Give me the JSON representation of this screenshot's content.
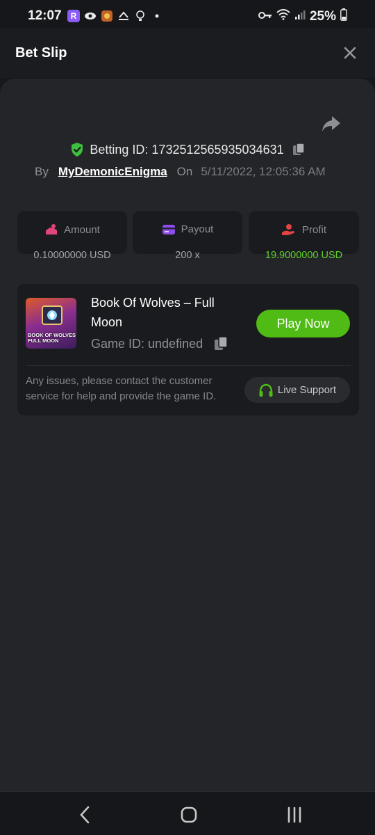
{
  "status_bar": {
    "time": "12:07",
    "battery": "25%",
    "app_badge": "R"
  },
  "header": {
    "title": "Bet Slip"
  },
  "bet": {
    "betting_id": "Betting ID: 1732512565935034631",
    "by_label": "By",
    "username": "MyDemonicEnigma",
    "on_label": "On",
    "date": "5/11/2022, 12:05:36 AM"
  },
  "stats": {
    "amount": {
      "label": "Amount",
      "value": "0.10000000 USD"
    },
    "payout": {
      "label": "Payout",
      "value": "200 x"
    },
    "profit": {
      "label": "Profit",
      "value": "19.9000000 USD"
    }
  },
  "game": {
    "title": "Book Of Wolves – Full Moon",
    "thumb_caption_1": "BOOK OF WOLVES",
    "thumb_caption_2": "FULL MOON",
    "game_id": "Game ID: undefined",
    "play_label": "Play Now",
    "issue_text": "Any issues, please contact the customer service for help and provide the game ID.",
    "support_label": "Live Support"
  },
  "colors": {
    "accent_green": "#4fbb14",
    "profit_green": "#5fcf2b",
    "amount_pink": "#e0457b",
    "payout_purple": "#8b4cf0",
    "profit_red": "#e04444"
  }
}
